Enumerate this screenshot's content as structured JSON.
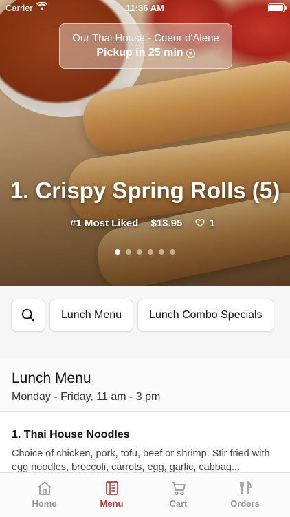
{
  "status_bar": {
    "carrier": "Carrier",
    "time": "11:36 AM"
  },
  "pickup": {
    "restaurant": "Our Thai House - Coeur d'Alene",
    "eta": "Pickup in 25 min"
  },
  "hero": {
    "title": "1. Crispy Spring Rolls (5)",
    "rank": "#1 Most Liked",
    "price": "$13.95",
    "likes": "1",
    "slides_total": 6,
    "active_slide": 1
  },
  "chips": [
    {
      "label": "Lunch Menu"
    },
    {
      "label": "Lunch Combo Specials"
    }
  ],
  "menu": {
    "title": "Lunch Menu",
    "hours": "Monday - Friday, 11 am - 3 pm",
    "items": [
      {
        "name": "1. Thai House Noodles",
        "description": "Choice of chicken, pork, tofu, beef or shrimp. Stir fried with egg noodles, broccoli, carrots, egg, garlic, cabbag..."
      }
    ]
  },
  "tabbar": {
    "accent": "#b43b3b",
    "tabs": [
      {
        "label": "Home",
        "icon": "home-icon"
      },
      {
        "label": "Menu",
        "icon": "menu-icon",
        "active": true
      },
      {
        "label": "Cart",
        "icon": "cart-icon"
      },
      {
        "label": "Orders",
        "icon": "utensils-icon"
      }
    ]
  }
}
